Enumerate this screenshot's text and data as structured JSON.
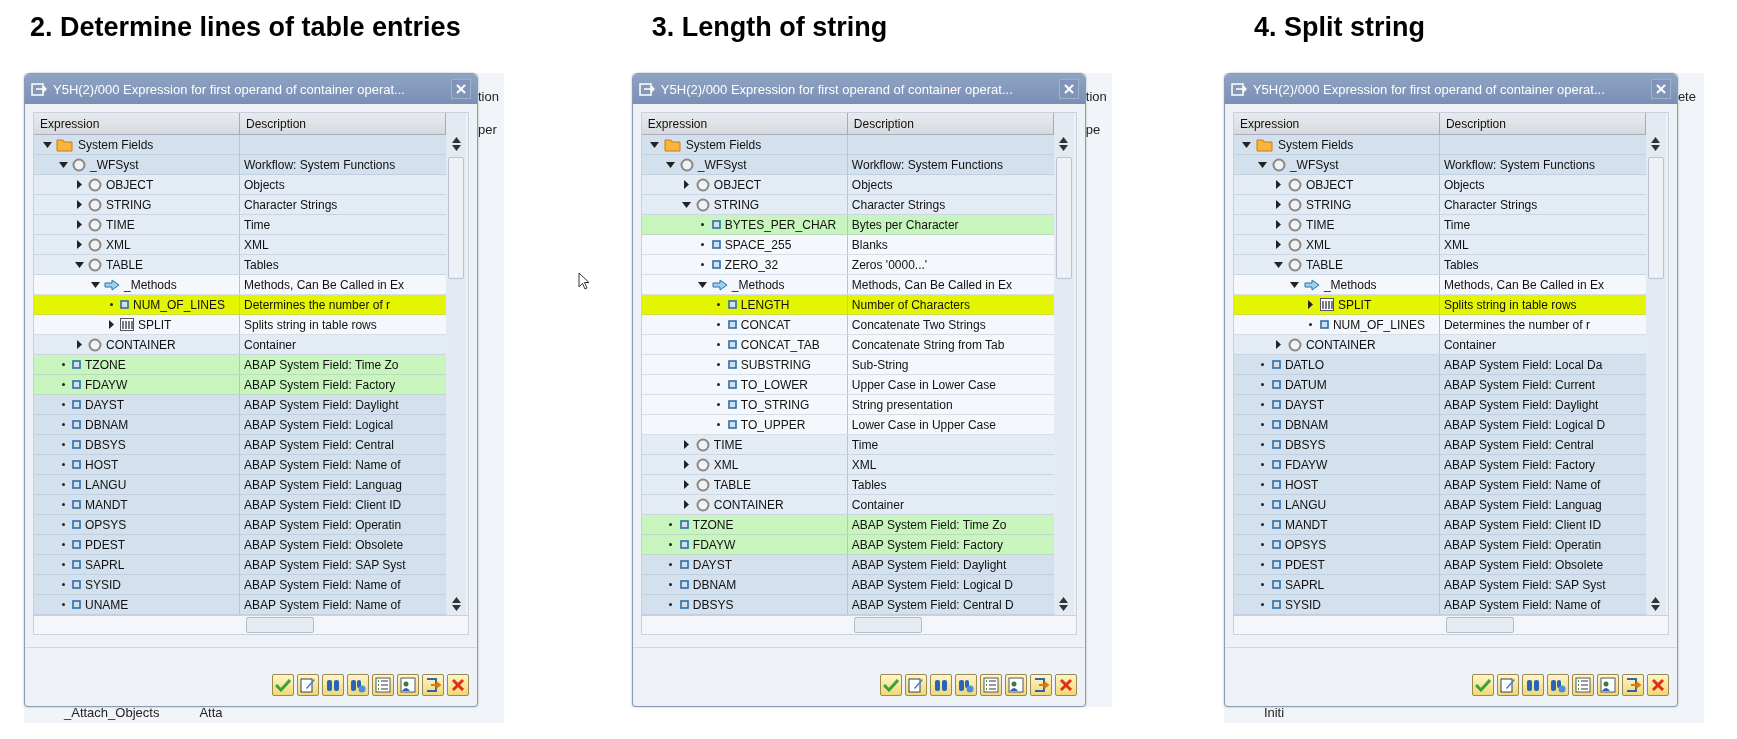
{
  "panels": [
    {
      "heading": "2. Determine lines of table entries",
      "behind": {
        "right_texts": [
          "tion",
          "per"
        ],
        "bottom_texts": [
          "_Attach_Objects",
          "Atta"
        ]
      },
      "dialog": {
        "title": "Y5H(2)/000 Expression for first operand of container operat...",
        "columns": [
          "Expression",
          "Description"
        ],
        "rows": [
          {
            "kind": "folder",
            "label": "System Fields",
            "expanded": true,
            "children": [
              {
                "kind": "circle",
                "label": "_WFSyst",
                "description": "Workflow: System Functions",
                "expanded": true,
                "children": [
                  {
                    "kind": "circle",
                    "label": "OBJECT",
                    "description": "Objects",
                    "expanded": false
                  },
                  {
                    "kind": "circle",
                    "label": "STRING",
                    "description": "Character Strings",
                    "expanded": false
                  },
                  {
                    "kind": "circle",
                    "label": "TIME",
                    "description": "Time",
                    "expanded": false
                  },
                  {
                    "kind": "circle",
                    "label": "XML",
                    "description": "XML",
                    "expanded": false
                  },
                  {
                    "kind": "circle",
                    "label": "TABLE",
                    "description": "Tables",
                    "expanded": true,
                    "children": [
                      {
                        "kind": "arrow",
                        "label": "_Methods",
                        "description": "Methods, Can Be Called in Ex",
                        "expanded": true,
                        "children": [
                          {
                            "kind": "field",
                            "label": "NUM_OF_LINES",
                            "description": "Determines the number of r",
                            "highlighted": true
                          },
                          {
                            "kind": "table",
                            "label": "SPLIT",
                            "description": "Splits string in table rows",
                            "expanded": false
                          }
                        ]
                      }
                    ]
                  },
                  {
                    "kind": "circle",
                    "label": "CONTAINER",
                    "description": "Container",
                    "expanded": false
                  }
                ]
              },
              {
                "kind": "field",
                "label": "TZONE",
                "description": "ABAP System Field: Time Zo",
                "tinted": true
              },
              {
                "kind": "field",
                "label": "FDAYW",
                "description": "ABAP System Field: Factory",
                "tinted": true
              },
              {
                "kind": "field",
                "label": "DAYST",
                "description": "ABAP System Field: Daylight"
              },
              {
                "kind": "field",
                "label": "DBNAM",
                "description": "ABAP System Field: Logical"
              },
              {
                "kind": "field",
                "label": "DBSYS",
                "description": "ABAP System Field: Central"
              },
              {
                "kind": "field",
                "label": "HOST",
                "description": "ABAP System Field: Name of"
              },
              {
                "kind": "field",
                "label": "LANGU",
                "description": "ABAP System Field: Languag"
              },
              {
                "kind": "field",
                "label": "MANDT",
                "description": "ABAP System Field: Client ID"
              },
              {
                "kind": "field",
                "label": "OPSYS",
                "description": "ABAP System Field: Operatin"
              },
              {
                "kind": "field",
                "label": "PDEST",
                "description": "ABAP System Field: Obsolete"
              },
              {
                "kind": "field",
                "label": "SAPRL",
                "description": "ABAP System Field: SAP Syst"
              },
              {
                "kind": "field",
                "label": "SYSID",
                "description": "ABAP System Field: Name of"
              },
              {
                "kind": "field",
                "label": "UNAME",
                "description": "ABAP System Field: Name of"
              }
            ]
          }
        ],
        "toolbar": [
          {
            "kind": "check"
          },
          {
            "kind": "edit"
          },
          {
            "kind": "find"
          },
          {
            "kind": "find-next"
          },
          {
            "kind": "list"
          },
          {
            "kind": "person"
          },
          {
            "kind": "transfer"
          },
          {
            "kind": "cancel"
          }
        ]
      }
    },
    {
      "heading": "3. Length of string",
      "behind": {
        "right_texts": [
          "tion",
          "pe"
        ]
      },
      "dialog": {
        "title": "Y5H(2)/000 Expression for first operand of container operat...",
        "columns": [
          "Expression",
          "Description"
        ],
        "rows": [
          {
            "kind": "folder",
            "label": "System Fields",
            "expanded": true,
            "children": [
              {
                "kind": "circle",
                "label": "_WFSyst",
                "description": "Workflow: System Functions",
                "expanded": true,
                "children": [
                  {
                    "kind": "circle",
                    "label": "OBJECT",
                    "description": "Objects",
                    "expanded": false
                  },
                  {
                    "kind": "circle",
                    "label": "STRING",
                    "description": "Character Strings",
                    "expanded": true,
                    "children": [
                      {
                        "kind": "field",
                        "label": "BYTES_PER_CHAR",
                        "description": "Bytes per Character",
                        "tinted": true
                      },
                      {
                        "kind": "field",
                        "label": "SPACE_255",
                        "description": "Blanks"
                      },
                      {
                        "kind": "field",
                        "label": "ZERO_32",
                        "description": "Zeros '0000...'"
                      },
                      {
                        "kind": "arrow",
                        "label": "_Methods",
                        "description": "Methods, Can Be Called in Ex",
                        "expanded": true,
                        "children": [
                          {
                            "kind": "field",
                            "label": "LENGTH",
                            "description": "Number of Characters",
                            "highlighted": true
                          },
                          {
                            "kind": "field",
                            "label": "CONCAT",
                            "description": "Concatenate Two Strings"
                          },
                          {
                            "kind": "field",
                            "label": "CONCAT_TAB",
                            "description": "Concatenate String from Tab"
                          },
                          {
                            "kind": "field",
                            "label": "SUBSTRING",
                            "description": "Sub-String"
                          },
                          {
                            "kind": "field",
                            "label": "TO_LOWER",
                            "description": "Upper Case in Lower Case"
                          },
                          {
                            "kind": "field",
                            "label": "TO_STRING",
                            "description": "String presentation"
                          },
                          {
                            "kind": "field",
                            "label": "TO_UPPER",
                            "description": "Lower Case in Upper Case"
                          }
                        ]
                      }
                    ]
                  },
                  {
                    "kind": "circle",
                    "label": "TIME",
                    "description": "Time",
                    "expanded": false
                  },
                  {
                    "kind": "circle",
                    "label": "XML",
                    "description": "XML",
                    "expanded": false
                  },
                  {
                    "kind": "circle",
                    "label": "TABLE",
                    "description": "Tables",
                    "expanded": false
                  },
                  {
                    "kind": "circle",
                    "label": "CONTAINER",
                    "description": "Container",
                    "expanded": false
                  }
                ]
              },
              {
                "kind": "field",
                "label": "TZONE",
                "description": "ABAP System Field: Time Zo",
                "tinted": true
              },
              {
                "kind": "field",
                "label": "FDAYW",
                "description": "ABAP System Field: Factory",
                "tinted": true
              },
              {
                "kind": "field",
                "label": "DAYST",
                "description": "ABAP System Field: Daylight"
              },
              {
                "kind": "field",
                "label": "DBNAM",
                "description": "ABAP System Field: Logical D"
              },
              {
                "kind": "field",
                "label": "DBSYS",
                "description": "ABAP System Field: Central D"
              }
            ]
          }
        ],
        "toolbar": [
          {
            "kind": "check"
          },
          {
            "kind": "edit"
          },
          {
            "kind": "find"
          },
          {
            "kind": "find-next"
          },
          {
            "kind": "list"
          },
          {
            "kind": "person"
          },
          {
            "kind": "transfer"
          },
          {
            "kind": "cancel"
          }
        ]
      }
    },
    {
      "heading": "4. Split string",
      "behind": {
        "right_texts": [
          "ete"
        ],
        "bottom_texts": [
          "Initi"
        ]
      },
      "dialog": {
        "title": "Y5H(2)/000 Expression for first operand of container operat...",
        "columns": [
          "Expression",
          "Description"
        ],
        "rows": [
          {
            "kind": "folder",
            "label": "System Fields",
            "expanded": true,
            "children": [
              {
                "kind": "circle",
                "label": "_WFSyst",
                "description": "Workflow: System Functions",
                "expanded": true,
                "children": [
                  {
                    "kind": "circle",
                    "label": "OBJECT",
                    "description": "Objects",
                    "expanded": false
                  },
                  {
                    "kind": "circle",
                    "label": "STRING",
                    "description": "Character Strings",
                    "expanded": false
                  },
                  {
                    "kind": "circle",
                    "label": "TIME",
                    "description": "Time",
                    "expanded": false
                  },
                  {
                    "kind": "circle",
                    "label": "XML",
                    "description": "XML",
                    "expanded": false
                  },
                  {
                    "kind": "circle",
                    "label": "TABLE",
                    "description": "Tables",
                    "expanded": true,
                    "children": [
                      {
                        "kind": "arrow",
                        "label": "_Methods",
                        "description": "Methods, Can Be Called in Ex",
                        "expanded": true,
                        "children": [
                          {
                            "kind": "table",
                            "label": "SPLIT",
                            "description": "Splits string in table rows",
                            "expanded": false,
                            "highlighted": true
                          },
                          {
                            "kind": "field",
                            "label": "NUM_OF_LINES",
                            "description": "Determines the number of r"
                          }
                        ]
                      }
                    ]
                  },
                  {
                    "kind": "circle",
                    "label": "CONTAINER",
                    "description": "Container",
                    "expanded": false
                  }
                ]
              },
              {
                "kind": "field",
                "label": "DATLO",
                "description": "ABAP System Field: Local Da"
              },
              {
                "kind": "field",
                "label": "DATUM",
                "description": "ABAP System Field: Current"
              },
              {
                "kind": "field",
                "label": "DAYST",
                "description": "ABAP System Field: Daylight"
              },
              {
                "kind": "field",
                "label": "DBNAM",
                "description": "ABAP System Field: Logical D"
              },
              {
                "kind": "field",
                "label": "DBSYS",
                "description": "ABAP System Field: Central"
              },
              {
                "kind": "field",
                "label": "FDAYW",
                "description": "ABAP System Field: Factory"
              },
              {
                "kind": "field",
                "label": "HOST",
                "description": "ABAP System Field: Name of"
              },
              {
                "kind": "field",
                "label": "LANGU",
                "description": "ABAP System Field: Languag"
              },
              {
                "kind": "field",
                "label": "MANDT",
                "description": "ABAP System Field: Client ID"
              },
              {
                "kind": "field",
                "label": "OPSYS",
                "description": "ABAP System Field: Operatin"
              },
              {
                "kind": "field",
                "label": "PDEST",
                "description": "ABAP System Field: Obsolete"
              },
              {
                "kind": "field",
                "label": "SAPRL",
                "description": "ABAP System Field: SAP Syst"
              },
              {
                "kind": "field",
                "label": "SYSID",
                "description": "ABAP System Field: Name of"
              }
            ]
          }
        ],
        "toolbar": [
          {
            "kind": "check"
          },
          {
            "kind": "edit"
          },
          {
            "kind": "find"
          },
          {
            "kind": "find-next"
          },
          {
            "kind": "list"
          },
          {
            "kind": "person"
          },
          {
            "kind": "transfer"
          },
          {
            "kind": "cancel"
          }
        ]
      }
    }
  ]
}
